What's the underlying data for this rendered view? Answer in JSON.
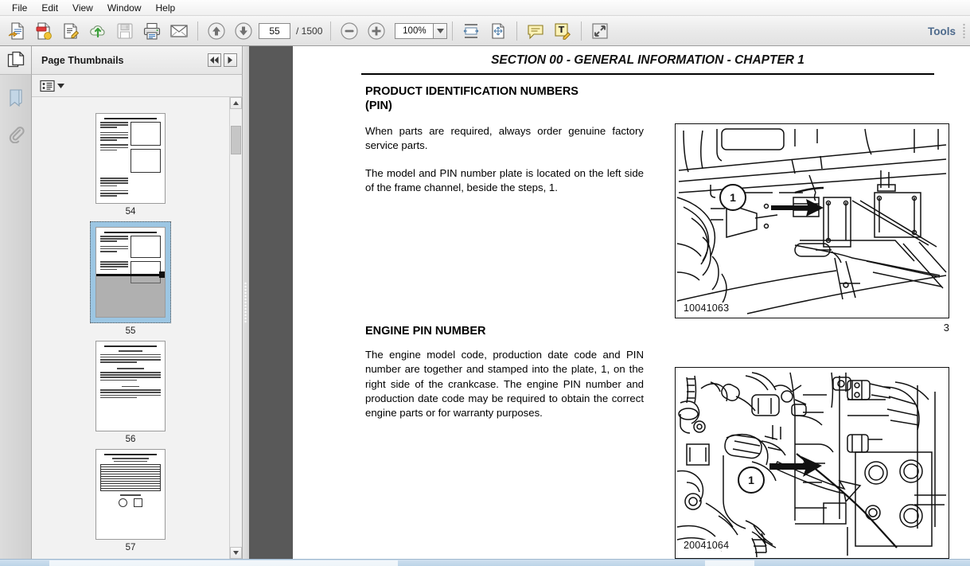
{
  "menubar": {
    "items": [
      {
        "label": "File"
      },
      {
        "label": "Edit"
      },
      {
        "label": "View"
      },
      {
        "label": "Window"
      },
      {
        "label": "Help"
      }
    ]
  },
  "toolbar": {
    "buttons": [
      {
        "name": "open-pdf-icon",
        "title": "Open"
      },
      {
        "name": "create-pdf-icon",
        "title": "Create PDF"
      },
      {
        "name": "edit-pdf-icon",
        "title": "Edit PDF"
      },
      {
        "name": "export-cloud-icon",
        "title": "Export"
      },
      {
        "name": "save-icon",
        "title": "Save"
      },
      {
        "name": "print-icon",
        "title": "Print"
      },
      {
        "name": "email-icon",
        "title": "Email"
      },
      {
        "name": "previous-page-icon",
        "title": "Previous Page"
      },
      {
        "name": "next-page-icon",
        "title": "Next Page"
      },
      {
        "name": "zoom-out-icon",
        "title": "Zoom Out"
      },
      {
        "name": "zoom-in-icon",
        "title": "Zoom In"
      },
      {
        "name": "fit-width-icon",
        "title": "Fit Width"
      },
      {
        "name": "fit-page-icon",
        "title": "Fit Page"
      },
      {
        "name": "comment-icon",
        "title": "Add Sticky Note"
      },
      {
        "name": "text-edit-icon",
        "title": "Add Text Comment"
      },
      {
        "name": "fullscreen-icon",
        "title": "Full Screen"
      }
    ],
    "page_current": "55",
    "page_total": "/ 1500",
    "zoom_value": "100%",
    "tools_label": "Tools"
  },
  "sidebar": {
    "rail_items": [
      {
        "name": "page-thumbnails-icon",
        "label": "Page Thumbnails",
        "selected": true
      },
      {
        "name": "bookmarks-icon",
        "label": "Bookmarks",
        "selected": false
      },
      {
        "name": "attachments-icon",
        "label": "Attachments",
        "selected": false
      }
    ],
    "panel_title": "Page Thumbnails",
    "nav_prev_label": "◀◀",
    "nav_next_label": "▶",
    "options_label": "Options",
    "thumbnails": [
      {
        "page": "54",
        "selected": false
      },
      {
        "page": "55",
        "selected": true
      },
      {
        "page": "56",
        "selected": false
      },
      {
        "page": "57",
        "selected": false
      }
    ]
  },
  "document": {
    "running_header": "SECTION 00 - GENERAL INFORMATION - CHAPTER 1",
    "sections": [
      {
        "heading_line1": "PRODUCT IDENTIFICATION NUMBERS",
        "heading_line2": "(PIN)",
        "paragraphs": [
          "When parts are required, always order genuine factory service parts.",
          "The model and PIN number plate is located on the left side of the frame channel, beside the steps, 1."
        ]
      },
      {
        "heading_line1": "ENGINE PIN NUMBER",
        "heading_line2": "",
        "paragraphs": [
          "The engine model code, production date code and PIN number are together and stamped into the plate, 1, on the right side of the crankcase. The engine PIN number and production date code may be required to obtain the correct engine parts or for warranty purposes."
        ]
      }
    ],
    "figures": [
      {
        "id": "10041063",
        "callout": "1",
        "number": "3"
      },
      {
        "id": "20041064",
        "callout": "1",
        "number": ""
      }
    ]
  },
  "colors": {
    "accent": "#4d6a8c",
    "selection": "#9cc6e3",
    "gutter": "#595959"
  }
}
